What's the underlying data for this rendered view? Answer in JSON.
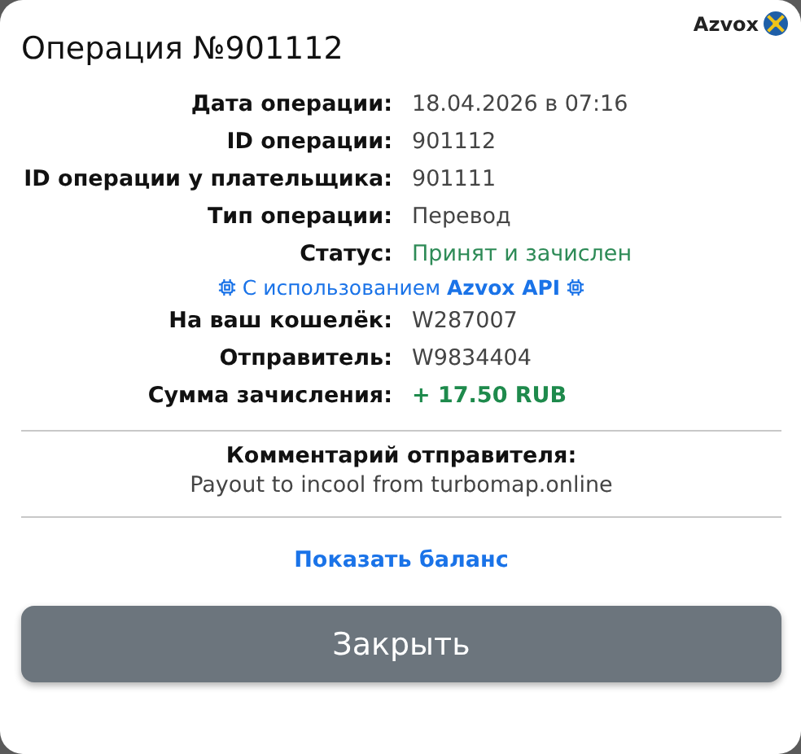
{
  "brand": {
    "name": "Azvox"
  },
  "title": "Операция №901112",
  "rows": [
    {
      "label": "Дата операции:",
      "value": "18.04.2026 в 07:16",
      "kind": "plain"
    },
    {
      "label": "ID операции:",
      "value": "901112",
      "kind": "plain"
    },
    {
      "label": "ID операции у плательщика:",
      "value": "901111",
      "kind": "plain"
    },
    {
      "label": "Тип операции:",
      "value": "Перевод",
      "kind": "plain"
    },
    {
      "label": "Статус:",
      "value": "Принят и зачислен",
      "kind": "status"
    }
  ],
  "api_note": "С использованием **Azvox API**",
  "rows2": [
    {
      "label": "На ваш кошелёк:",
      "value": "W287007",
      "kind": "plain"
    },
    {
      "label": "Отправитель:",
      "value": "W9834404",
      "kind": "plain"
    },
    {
      "label": "Сумма зачисления:",
      "value": "+ 17.50 RUB",
      "kind": "amount"
    }
  ],
  "comment": {
    "title": "Комментарий отправителя:",
    "text": "Payout to incool from turbomap.online"
  },
  "link": "Показать баланс",
  "button": "Закрыть"
}
